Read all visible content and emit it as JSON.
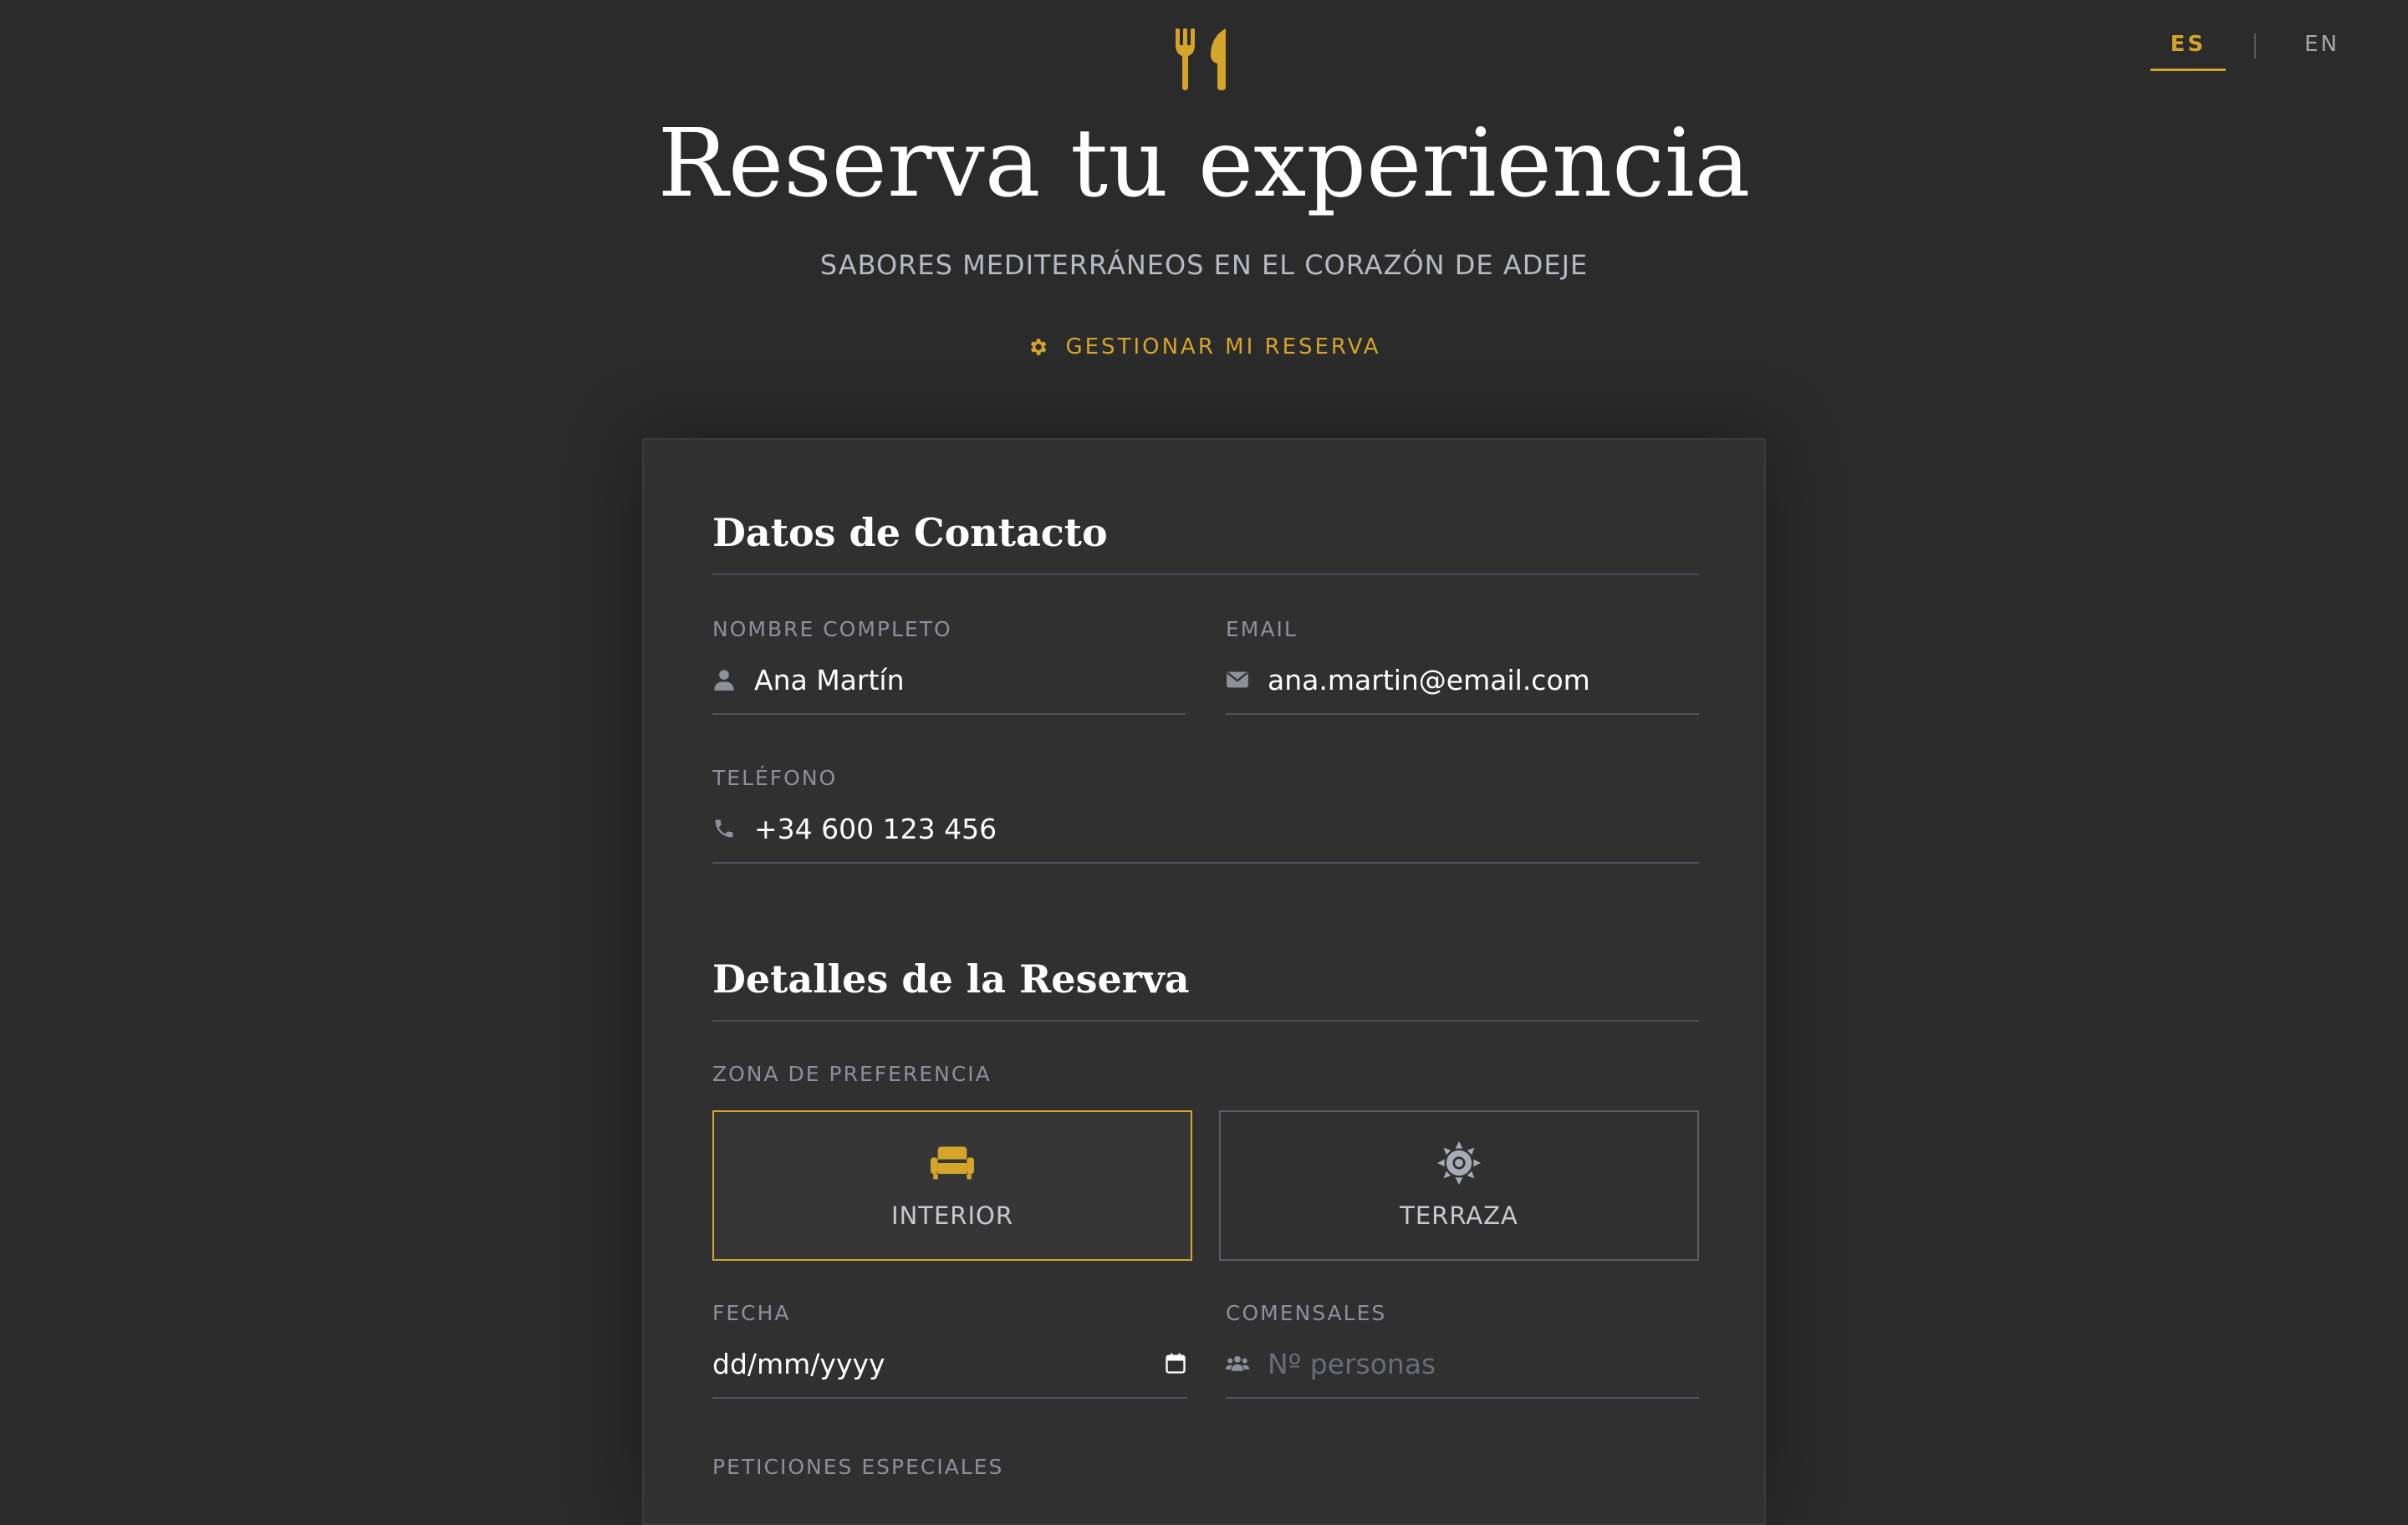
{
  "lang": {
    "options": [
      {
        "label": "ES",
        "active": true
      },
      {
        "label": "EN",
        "active": false
      }
    ]
  },
  "header": {
    "logo_icon": "fork-knife-icon",
    "title": "Reserva tu experiencia",
    "subtitle": "SABORES MEDITERRÁNEOS EN EL CORAZÓN DE ADEJE",
    "manage_link": "GESTIONAR MI RESERVA",
    "manage_icon": "gear-icon"
  },
  "contact": {
    "title": "Datos de Contacto",
    "name": {
      "label": "NOMBRE COMPLETO",
      "value": "Ana Martín",
      "icon": "user-icon"
    },
    "email": {
      "label": "EMAIL",
      "value": "ana.martin@email.com",
      "icon": "envelope-icon"
    },
    "phone": {
      "label": "TELÉFONO",
      "value": "+34 600 123 456",
      "icon": "phone-icon"
    }
  },
  "details": {
    "title": "Detalles de la Reserva",
    "zone_label": "ZONA DE PREFERENCIA",
    "zones": [
      {
        "label": "INTERIOR",
        "icon": "sofa-icon",
        "selected": true
      },
      {
        "label": "TERRAZA",
        "icon": "sun-icon",
        "selected": false
      }
    ],
    "date": {
      "label": "FECHA",
      "placeholder": "dd/mm/yyyy",
      "icon": "calendar-icon"
    },
    "guests": {
      "label": "COMENSALES",
      "placeholder": "Nº personas",
      "icon": "users-icon"
    },
    "special_requests_label": "PETICIONES ESPECIALES"
  },
  "colors": {
    "background": "#2b2b2b",
    "card": "#303030",
    "accent": "#d4a52a",
    "muted": "#8e909b"
  }
}
